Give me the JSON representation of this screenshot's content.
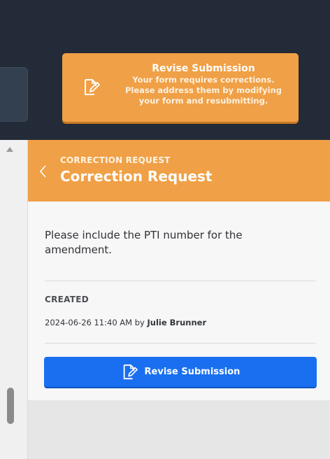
{
  "notice": {
    "icon": "edit-document-icon",
    "title": "Revise Submission",
    "body_lines": [
      "Your form requires corrections.",
      "Please address them by modifying",
      "your form and resubmitting."
    ]
  },
  "panel": {
    "kicker": "CORRECTION REQUEST",
    "title": "Correction Request",
    "back_icon": "chevron-left-icon",
    "message": "Please include the PTI number for the amendment.",
    "created_label": "CREATED",
    "created_datetime": "2024-06-26 11:40 AM",
    "created_by_prefix": "by",
    "created_by": "Julie Brunner",
    "revise_button_label": "Revise Submission",
    "revise_button_icon": "edit-document-icon"
  },
  "colors": {
    "header_dark": "#232a38",
    "accent_orange": "#f0a046",
    "primary_blue": "#1a6ff0"
  }
}
